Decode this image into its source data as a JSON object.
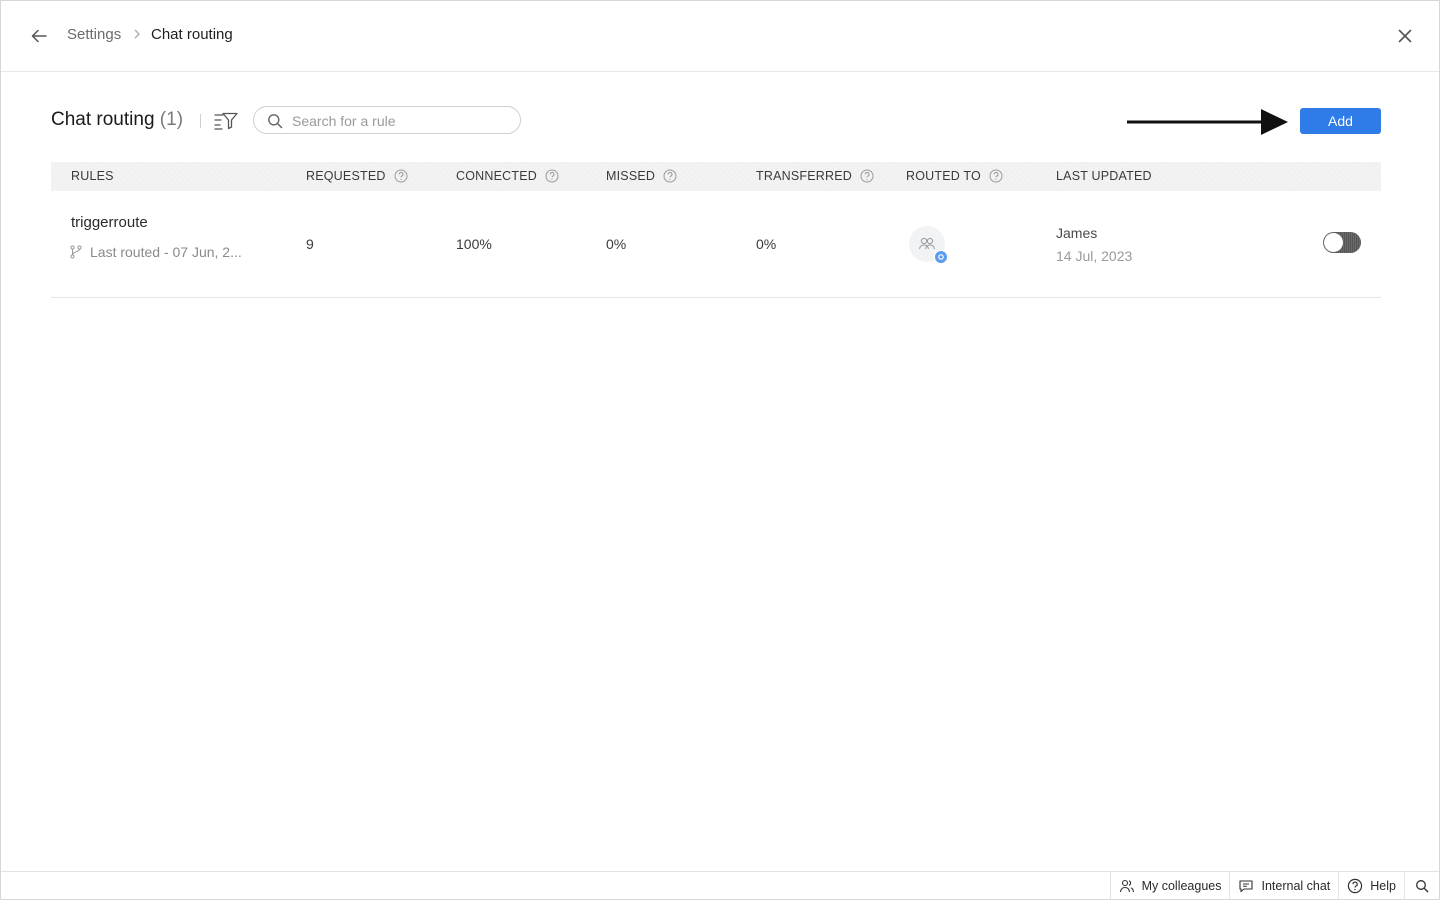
{
  "breadcrumb": {
    "root": "Settings",
    "current": "Chat routing"
  },
  "header": {
    "title": "Chat routing",
    "count": "(1)",
    "search_placeholder": "Search for a rule",
    "add_label": "Add"
  },
  "table": {
    "columns": [
      "RULES",
      "REQUESTED",
      "CONNECTED",
      "MISSED",
      "TRANSFERRED",
      "ROUTED TO",
      "LAST UPDATED"
    ],
    "rows": [
      {
        "name": "triggerroute",
        "last_routed": "Last routed - 07 Jun, 2...",
        "requested": "9",
        "connected": "100%",
        "missed": "0%",
        "transferred": "0%",
        "updated_by": "James",
        "updated_on": "14 Jul, 2023",
        "enabled": false
      }
    ]
  },
  "footer": {
    "colleagues": "My colleagues",
    "internal_chat": "Internal chat",
    "help": "Help"
  },
  "colors": {
    "accent": "#2f7ce8"
  }
}
